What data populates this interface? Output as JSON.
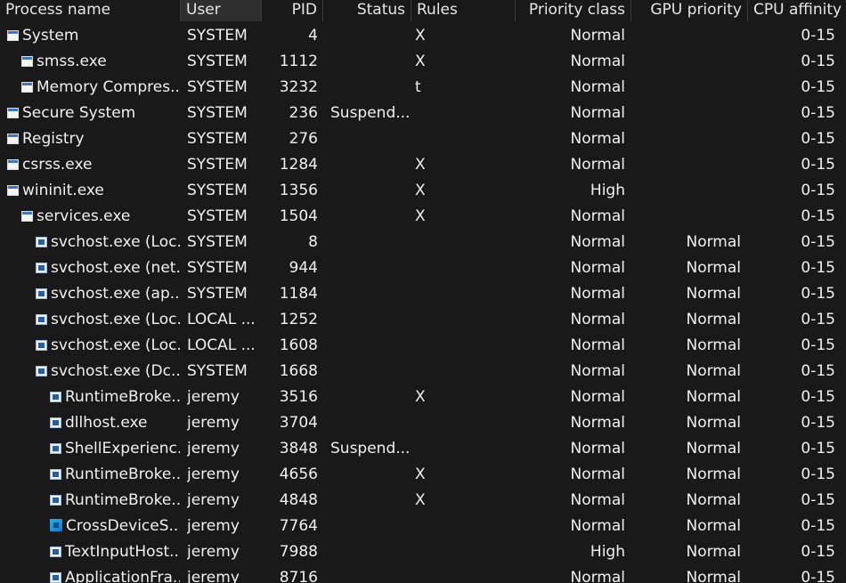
{
  "columns": {
    "name": "Process name",
    "user": "User",
    "pid": "PID",
    "status": "Status",
    "rules": "Rules",
    "priority": "Priority class",
    "gpu": "GPU priority",
    "affinity": "CPU affinity"
  },
  "rows": [
    {
      "name": "System",
      "user": "SYSTEM",
      "pid": "4",
      "status": "",
      "rules": "X",
      "priority": "Normal",
      "gpu": "",
      "affinity": "0-15",
      "icon": "window-icon",
      "depth": 1
    },
    {
      "name": "smss.exe",
      "user": "SYSTEM",
      "pid": "1112",
      "status": "",
      "rules": "X",
      "priority": "Normal",
      "gpu": "",
      "affinity": "0-15",
      "icon": "window-icon",
      "depth": 2
    },
    {
      "name": "Memory Compres...",
      "user": "SYSTEM",
      "pid": "3232",
      "status": "",
      "rules": "t",
      "priority": "Normal",
      "gpu": "",
      "affinity": "0-15",
      "icon": "window-icon",
      "depth": 2
    },
    {
      "name": "Secure System",
      "user": "SYSTEM",
      "pid": "236",
      "status": "Suspend...",
      "rules": "",
      "priority": "Normal",
      "gpu": "",
      "affinity": "0-15",
      "icon": "window-icon",
      "depth": 1
    },
    {
      "name": "Registry",
      "user": "SYSTEM",
      "pid": "276",
      "status": "",
      "rules": "",
      "priority": "Normal",
      "gpu": "",
      "affinity": "0-15",
      "icon": "window-icon",
      "depth": 1
    },
    {
      "name": "csrss.exe",
      "user": "SYSTEM",
      "pid": "1284",
      "status": "",
      "rules": "X",
      "priority": "Normal",
      "gpu": "",
      "affinity": "0-15",
      "icon": "window-icon",
      "depth": 1
    },
    {
      "name": "wininit.exe",
      "user": "SYSTEM",
      "pid": "1356",
      "status": "",
      "rules": "X",
      "priority": "High",
      "gpu": "",
      "affinity": "0-15",
      "icon": "window-icon",
      "depth": 1
    },
    {
      "name": "services.exe",
      "user": "SYSTEM",
      "pid": "1504",
      "status": "",
      "rules": "X",
      "priority": "Normal",
      "gpu": "",
      "affinity": "0-15",
      "icon": "window-icon",
      "depth": 2
    },
    {
      "name": "svchost.exe (Loc...",
      "user": "SYSTEM",
      "pid": "8",
      "status": "",
      "rules": "",
      "priority": "Normal",
      "gpu": "Normal",
      "affinity": "0-15",
      "icon": "service-icon",
      "depth": 3
    },
    {
      "name": "svchost.exe (net...",
      "user": "SYSTEM",
      "pid": "944",
      "status": "",
      "rules": "",
      "priority": "Normal",
      "gpu": "Normal",
      "affinity": "0-15",
      "icon": "service-icon",
      "depth": 3
    },
    {
      "name": "svchost.exe (ap...",
      "user": "SYSTEM",
      "pid": "1184",
      "status": "",
      "rules": "",
      "priority": "Normal",
      "gpu": "Normal",
      "affinity": "0-15",
      "icon": "service-icon",
      "depth": 3
    },
    {
      "name": "svchost.exe (Loc...",
      "user": "LOCAL ...",
      "pid": "1252",
      "status": "",
      "rules": "",
      "priority": "Normal",
      "gpu": "Normal",
      "affinity": "0-15",
      "icon": "service-icon",
      "depth": 3
    },
    {
      "name": "svchost.exe (Loc...",
      "user": "LOCAL ...",
      "pid": "1608",
      "status": "",
      "rules": "",
      "priority": "Normal",
      "gpu": "Normal",
      "affinity": "0-15",
      "icon": "service-icon",
      "depth": 3
    },
    {
      "name": "svchost.exe (Dc...",
      "user": "SYSTEM",
      "pid": "1668",
      "status": "",
      "rules": "",
      "priority": "Normal",
      "gpu": "Normal",
      "affinity": "0-15",
      "icon": "service-icon",
      "depth": 3
    },
    {
      "name": "RuntimeBroke...",
      "user": "jeremy",
      "pid": "3516",
      "status": "",
      "rules": "X",
      "priority": "Normal",
      "gpu": "Normal",
      "affinity": "0-15",
      "icon": "service-icon",
      "depth": 4
    },
    {
      "name": "dllhost.exe",
      "user": "jeremy",
      "pid": "3704",
      "status": "",
      "rules": "",
      "priority": "Normal",
      "gpu": "Normal",
      "affinity": "0-15",
      "icon": "service-icon",
      "depth": 4
    },
    {
      "name": "ShellExperienc...",
      "user": "jeremy",
      "pid": "3848",
      "status": "Suspend...",
      "rules": "",
      "priority": "Normal",
      "gpu": "Normal",
      "affinity": "0-15",
      "icon": "service-icon",
      "depth": 4
    },
    {
      "name": "RuntimeBroke...",
      "user": "jeremy",
      "pid": "4656",
      "status": "",
      "rules": "X",
      "priority": "Normal",
      "gpu": "Normal",
      "affinity": "0-15",
      "icon": "service-icon",
      "depth": 4
    },
    {
      "name": "RuntimeBroke...",
      "user": "jeremy",
      "pid": "4848",
      "status": "",
      "rules": "X",
      "priority": "Normal",
      "gpu": "Normal",
      "affinity": "0-15",
      "icon": "service-icon",
      "depth": 4
    },
    {
      "name": "CrossDeviceS...",
      "user": "jeremy",
      "pid": "7764",
      "status": "",
      "rules": "",
      "priority": "Normal",
      "gpu": "Normal",
      "affinity": "0-15",
      "icon": "cross-device-icon",
      "depth": 4
    },
    {
      "name": "TextInputHost....",
      "user": "jeremy",
      "pid": "7988",
      "status": "",
      "rules": "",
      "priority": "High",
      "gpu": "Normal",
      "affinity": "0-15",
      "icon": "service-icon",
      "depth": 4
    },
    {
      "name": "ApplicationFra...",
      "user": "jeremy",
      "pid": "8716",
      "status": "",
      "rules": "",
      "priority": "Normal",
      "gpu": "Normal",
      "affinity": "0-15",
      "icon": "service-icon",
      "depth": 4
    }
  ]
}
